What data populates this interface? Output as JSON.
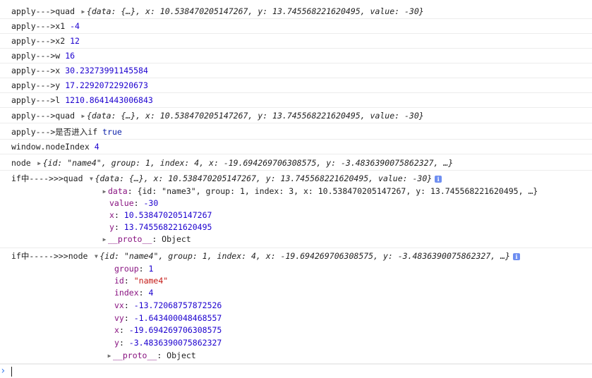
{
  "lines": [
    {
      "label": "apply--->quad",
      "type": "object",
      "preview": "{data: {…}, x: 10.538470205147267, y: 13.745568221620495, value: -30}"
    },
    {
      "label": "apply--->x1",
      "value": "-4"
    },
    {
      "label": "apply--->x2",
      "value": "12"
    },
    {
      "label": "apply--->w",
      "value": "16"
    },
    {
      "label": "apply--->x",
      "value": "30.23273991145584"
    },
    {
      "label": "apply--->y",
      "value": "17.22920722920673"
    },
    {
      "label": "apply--->l",
      "value": "1210.8641443006843"
    },
    {
      "label": "apply--->quad",
      "type": "object",
      "preview": "{data: {…}, x: 10.538470205147267, y: 13.745568221620495, value: -30}"
    },
    {
      "label": "apply--->是否进入if",
      "value": "true"
    },
    {
      "label": "window.nodeIndex",
      "value": "4"
    },
    {
      "label": "node",
      "type": "object",
      "preview": "{id: \"name4\", group: 1, index: 4, x: -19.694269706308575, y: -3.4836390075862327, …}"
    }
  ],
  "quad_expanded": {
    "label": "if中---->>>quad",
    "preview": "{data: {…}, x: 10.538470205147267, y: 13.745568221620495, value: -30}",
    "props": [
      {
        "key": "data",
        "value": "{id: \"name3\", group: 1, index: 3, x: 10.538470205147267, y: 13.745568221620495, …}",
        "collapsed": true
      },
      {
        "key": "value",
        "value": "-30"
      },
      {
        "key": "x",
        "value": "10.538470205147267"
      },
      {
        "key": "y",
        "value": "13.745568221620495"
      },
      {
        "key": "__proto__",
        "value": "Object"
      }
    ]
  },
  "node_expanded": {
    "label": "if中----->>>node",
    "preview": "{id: \"name4\", group: 1, index: 4, x: -19.694269706308575, y: -3.4836390075862327, …}",
    "props": [
      {
        "key": "group",
        "value": "1"
      },
      {
        "key": "id",
        "value": "\"name4\""
      },
      {
        "key": "index",
        "value": "4"
      },
      {
        "key": "vx",
        "value": "-13.72068757872526"
      },
      {
        "key": "vy",
        "value": "-1.643400048468557"
      },
      {
        "key": "x",
        "value": "-19.694269706308575"
      },
      {
        "key": "y",
        "value": "-3.4836390075862327"
      },
      {
        "key": "__proto__",
        "value": "Object"
      }
    ]
  },
  "icons": {
    "expand": "triangle-right-icon",
    "collapse": "triangle-down-icon",
    "info": "info-icon",
    "prompt": "chevron-right-icon"
  },
  "colors": {
    "number": "#1c00cf",
    "string": "#c41a16",
    "key": "#881280",
    "prompt": "#3b7ded"
  }
}
